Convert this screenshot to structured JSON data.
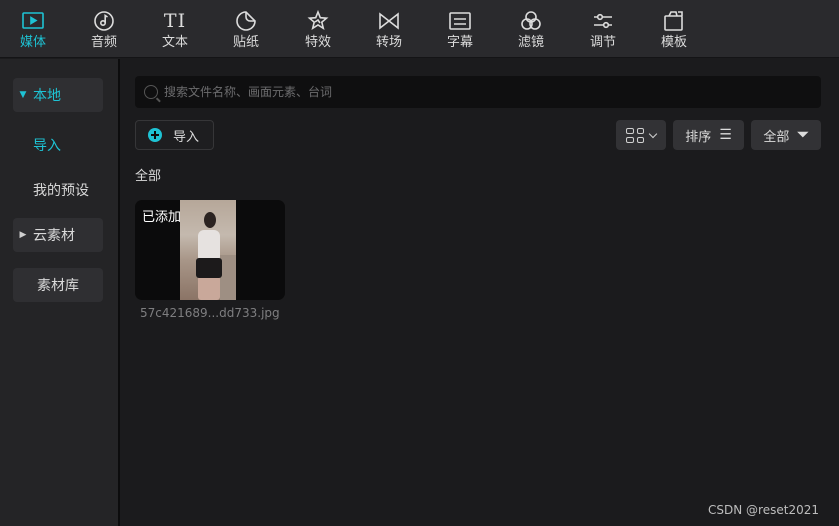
{
  "toolbar": {
    "tabs": [
      {
        "label": "媒体",
        "icon": "media-icon",
        "active": true
      },
      {
        "label": "音频",
        "icon": "audio-icon",
        "active": false
      },
      {
        "label": "文本",
        "icon": "text-icon",
        "active": false
      },
      {
        "label": "贴纸",
        "icon": "sticker-icon",
        "active": false
      },
      {
        "label": "特效",
        "icon": "effects-icon",
        "active": false
      },
      {
        "label": "转场",
        "icon": "transition-icon",
        "active": false
      },
      {
        "label": "字幕",
        "icon": "subtitle-icon",
        "active": false
      },
      {
        "label": "滤镜",
        "icon": "filter-icon",
        "active": false
      },
      {
        "label": "调节",
        "icon": "adjust-icon",
        "active": false
      },
      {
        "label": "模板",
        "icon": "template-icon",
        "active": false
      }
    ],
    "text_glyph": "TI"
  },
  "sidebar": {
    "local": "本地",
    "import": "导入",
    "my_presets": "我的预设",
    "cloud": "云素材",
    "library": "素材库"
  },
  "main": {
    "search_placeholder": "搜索文件名称、画面元素、台词",
    "import_button": "导入",
    "sort_button": "排序",
    "filter_button": "全部",
    "section_label": "全部",
    "media": [
      {
        "tag": "已添加",
        "file_name": "57c421689...dd733.jpg"
      }
    ]
  },
  "watermark": "CSDN @reset2021",
  "colors": {
    "accent": "#1ec3d4",
    "toolbar_bg": "#2a2a2d",
    "panel_bg": "#1b1b1d",
    "sidebar_bg": "#242426"
  }
}
